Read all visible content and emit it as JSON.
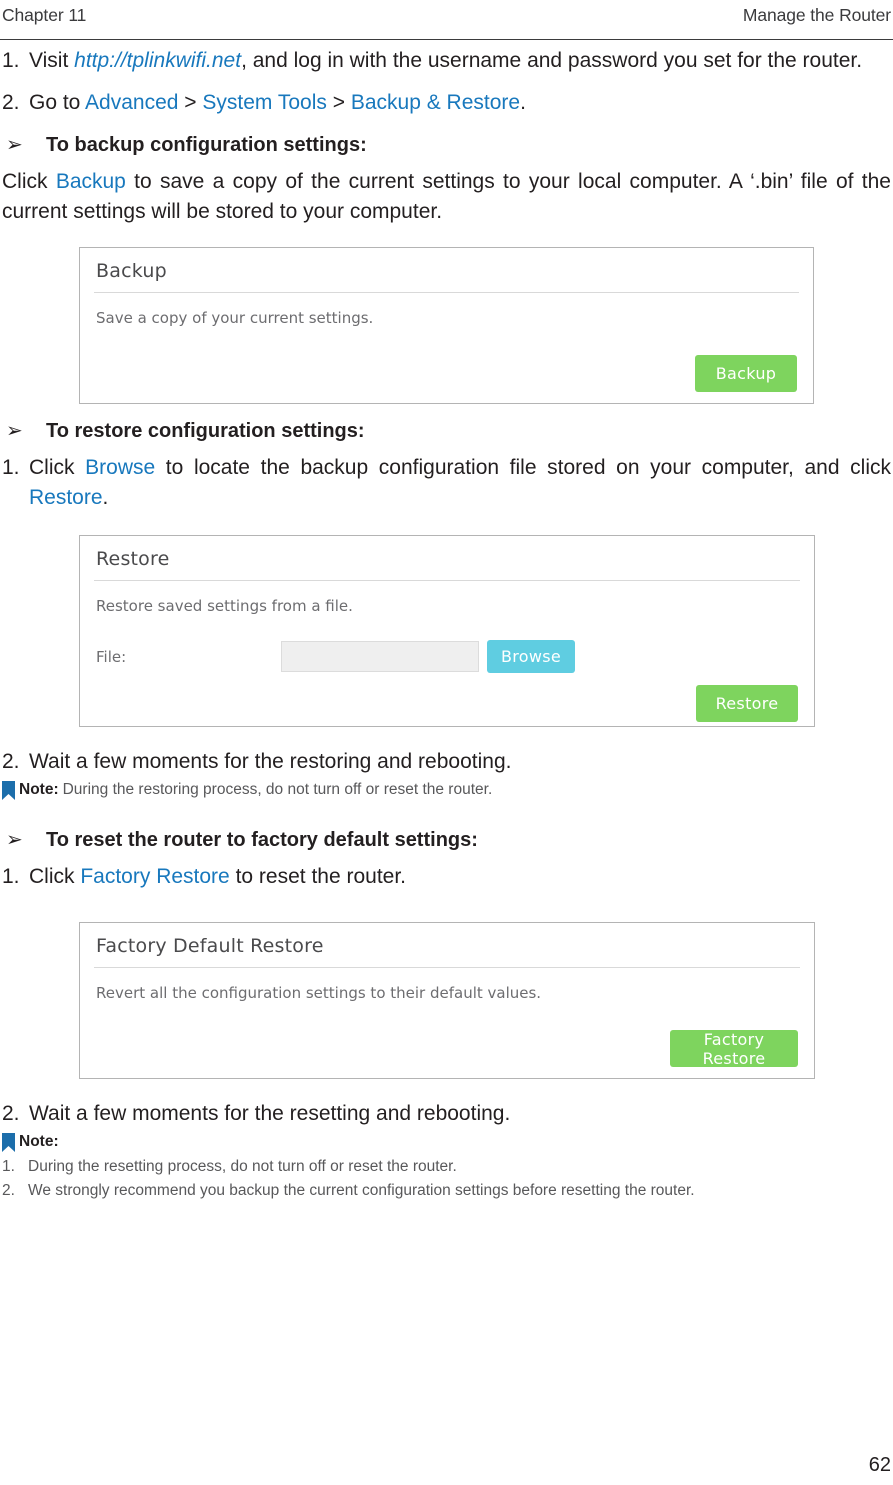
{
  "header": {
    "left": "Chapter 11",
    "right": "Manage the Router"
  },
  "steps_top": {
    "step1": {
      "number": "1.",
      "text_before": "Visit ",
      "link": "http://tplinkwifi.net",
      "text_after": ", and log in with the username and password you set for the router."
    },
    "step2": {
      "number": "2.",
      "text_before": "Go to ",
      "link1": "Advanced",
      "sep1": " > ",
      "link2": "System Tools",
      "sep2": " > ",
      "link3": "Backup & Restore",
      "text_after": "."
    }
  },
  "section_backup": {
    "arrow": "➢",
    "heading": "To backup configuration settings:",
    "paragraph_before": "Click ",
    "paragraph_link": "Backup",
    "paragraph_after": " to save a copy of the current settings to your local computer. A ‘.bin’ file of the current settings will be stored to your computer.",
    "panel": {
      "title": "Backup",
      "description": "Save a copy of your current settings.",
      "button": "Backup"
    }
  },
  "section_restore": {
    "arrow": "➢",
    "heading": "To restore configuration settings:",
    "step1": {
      "number": "1.",
      "text_before": "Click ",
      "link1": "Browse",
      "text_mid": " to locate the backup configuration file stored on your computer, and click ",
      "link2": "Restore",
      "text_after": "."
    },
    "panel": {
      "title": "Restore",
      "description": "Restore saved settings from a file.",
      "file_label": "File:",
      "file_value": "",
      "file_placeholder": "",
      "browse_button": "Browse",
      "restore_button": "Restore"
    },
    "step2": {
      "number": "2.",
      "text": "Wait a few moments for the restoring and rebooting."
    },
    "note": {
      "icon": "bookmark-icon",
      "label": "Note:",
      "text": "During the restoring process, do not turn off or reset the router."
    }
  },
  "section_factory": {
    "arrow": "➢",
    "heading": "To reset the router to factory default settings:",
    "step1": {
      "number": "1.",
      "text_before": "Click ",
      "link": "Factory Restore",
      "text_after": " to reset the router."
    },
    "panel": {
      "title": "Factory Default Restore",
      "description": "Revert all the configuration settings to their default values.",
      "button": "Factory Restore"
    },
    "step2": {
      "number": "2.",
      "text": "Wait a few moments for the resetting and rebooting."
    },
    "note": {
      "icon": "bookmark-icon",
      "label": "Note:",
      "items": [
        {
          "number": "1.",
          "text": "During the resetting process, do not turn off or reset the router."
        },
        {
          "number": "2.",
          "text": "We strongly recommend you backup the current configuration settings before resetting the router."
        }
      ]
    }
  },
  "footer": {
    "page_number": "62"
  },
  "colors": {
    "link": "#1878bd",
    "button_green": "#7ed45e",
    "button_cyan": "#5fcde1",
    "note_icon_blue": "#1c6eab",
    "panel_border": "#b4b4b4",
    "text": "#231f20",
    "muted_text": "#58585a"
  }
}
